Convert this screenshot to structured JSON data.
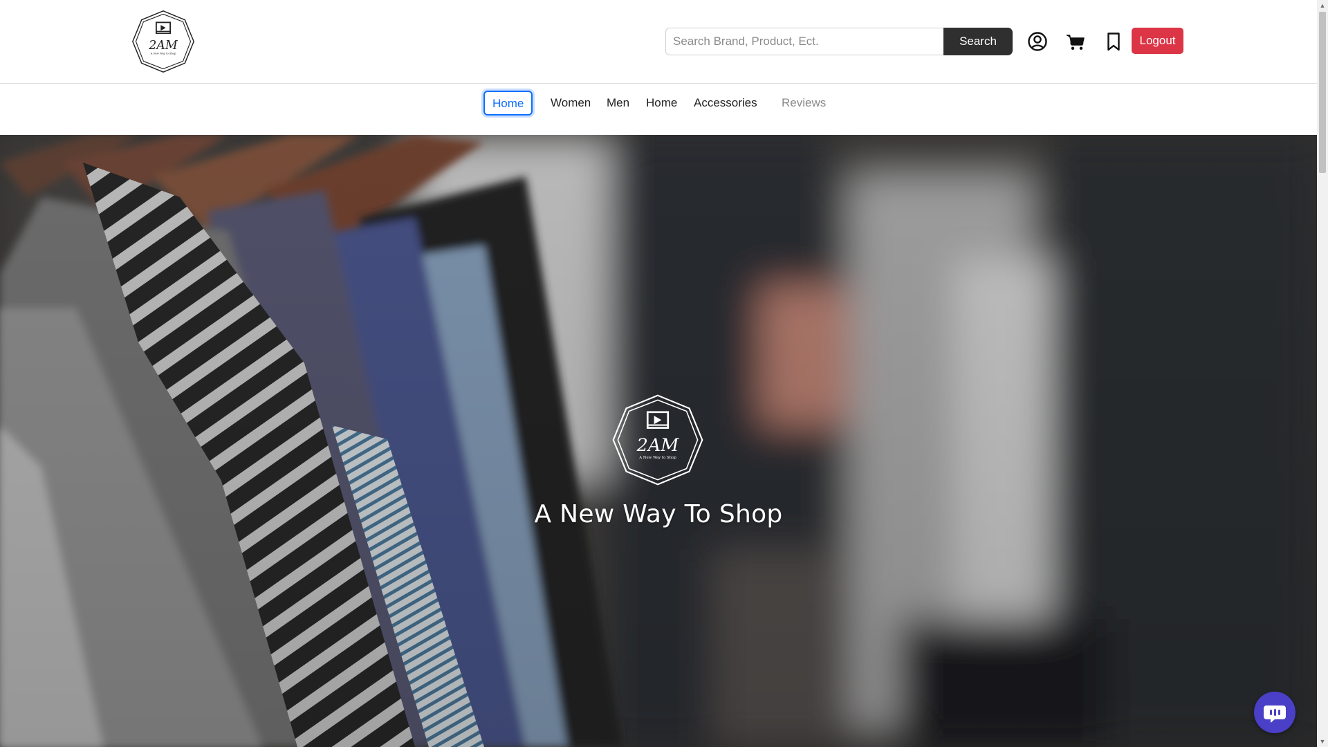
{
  "brand": {
    "logo_text": "2AM",
    "logo_tagline": "A New Way to Shop"
  },
  "header": {
    "search_placeholder": "Search Brand, Product, Ect.",
    "search_button": "Search",
    "icons": [
      "user-circle-icon",
      "cart-icon",
      "bookmark-icon"
    ],
    "logout_button": "Logout"
  },
  "nav": {
    "items": [
      {
        "label": "Home",
        "active": true
      },
      {
        "label": "Women"
      },
      {
        "label": "Men"
      },
      {
        "label": "Home"
      },
      {
        "label": "Accessories"
      },
      {
        "label": "Reviews",
        "muted": true
      }
    ]
  },
  "hero": {
    "title": "A New Way To Shop"
  },
  "chat": {
    "icon": "chat-bubble-icon"
  },
  "colors": {
    "logout": "#dc3545",
    "search_button": "#2f2f2f",
    "active_nav": "#0d6efd",
    "chat_button": "#4a3fc7"
  }
}
